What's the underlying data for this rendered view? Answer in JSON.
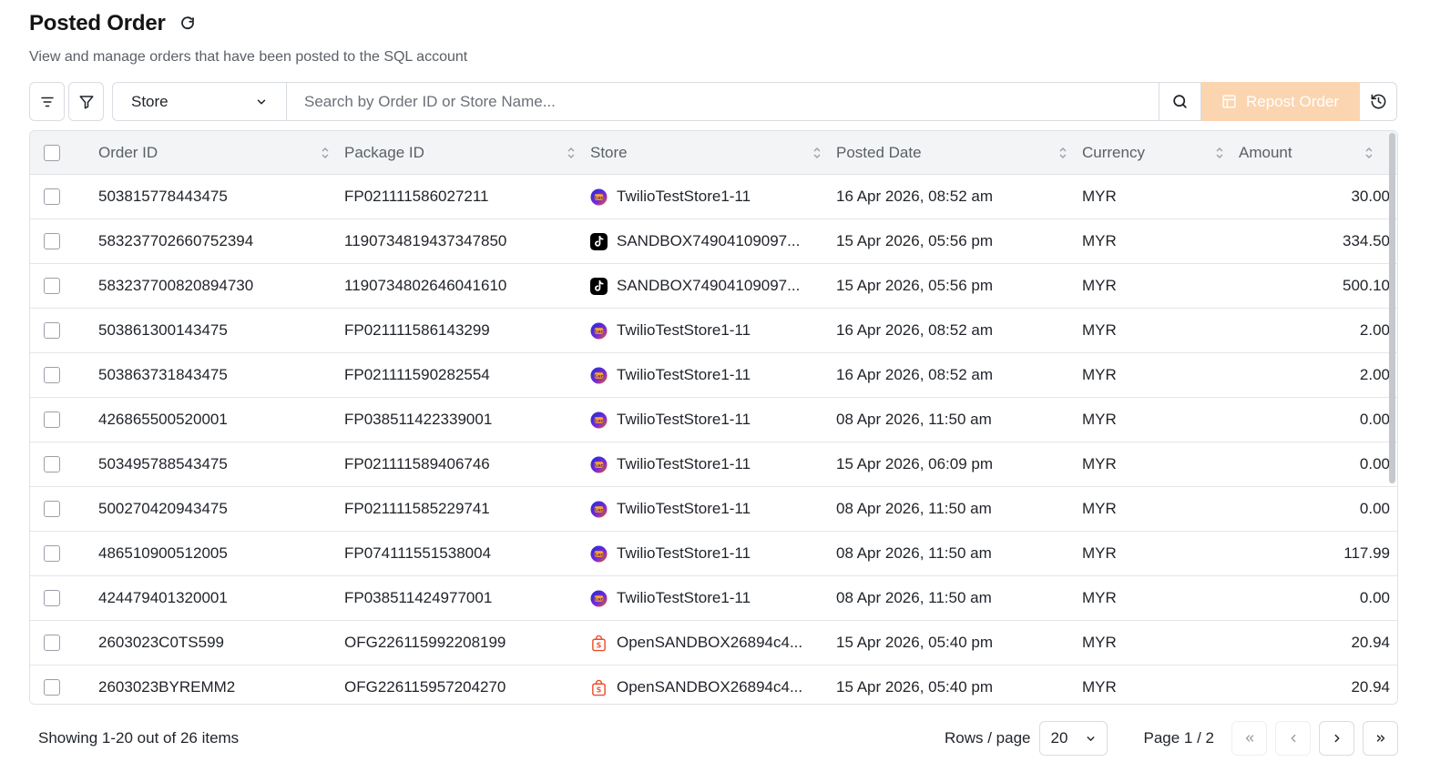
{
  "header": {
    "title": "Posted Order",
    "subtitle": "View and manage orders that have been posted to the SQL account"
  },
  "toolbar": {
    "store_select_label": "Store",
    "search_placeholder": "Search by Order ID or Store Name...",
    "repost_label": "Repost Order"
  },
  "table": {
    "columns": [
      "Order ID",
      "Package ID",
      "Store",
      "Posted Date",
      "Currency",
      "Amount"
    ],
    "rows": [
      {
        "order_id": "503815778443475",
        "package_id": "FP021111586027211",
        "store_icon": "lazada-icon",
        "store": "TwilioTestStore1-11",
        "posted_date": "16 Apr 2026, 08:52 am",
        "currency": "MYR",
        "amount": "30.00"
      },
      {
        "order_id": "583237702660752394",
        "package_id": "1190734819437347850",
        "store_icon": "tiktok-icon",
        "store": "SANDBOX74904109097...",
        "posted_date": "15 Apr 2026, 05:56 pm",
        "currency": "MYR",
        "amount": "334.50"
      },
      {
        "order_id": "583237700820894730",
        "package_id": "1190734802646041610",
        "store_icon": "tiktok-icon",
        "store": "SANDBOX74904109097...",
        "posted_date": "15 Apr 2026, 05:56 pm",
        "currency": "MYR",
        "amount": "500.10"
      },
      {
        "order_id": "503861300143475",
        "package_id": "FP021111586143299",
        "store_icon": "lazada-icon",
        "store": "TwilioTestStore1-11",
        "posted_date": "16 Apr 2026, 08:52 am",
        "currency": "MYR",
        "amount": "2.00"
      },
      {
        "order_id": "503863731843475",
        "package_id": "FP021111590282554",
        "store_icon": "lazada-icon",
        "store": "TwilioTestStore1-11",
        "posted_date": "16 Apr 2026, 08:52 am",
        "currency": "MYR",
        "amount": "2.00"
      },
      {
        "order_id": "426865500520001",
        "package_id": "FP038511422339001",
        "store_icon": "lazada-icon",
        "store": "TwilioTestStore1-11",
        "posted_date": "08 Apr 2026, 11:50 am",
        "currency": "MYR",
        "amount": "0.00"
      },
      {
        "order_id": "503495788543475",
        "package_id": "FP021111589406746",
        "store_icon": "lazada-icon",
        "store": "TwilioTestStore1-11",
        "posted_date": "15 Apr 2026, 06:09 pm",
        "currency": "MYR",
        "amount": "0.00"
      },
      {
        "order_id": "500270420943475",
        "package_id": "FP021111585229741",
        "store_icon": "lazada-icon",
        "store": "TwilioTestStore1-11",
        "posted_date": "08 Apr 2026, 11:50 am",
        "currency": "MYR",
        "amount": "0.00"
      },
      {
        "order_id": "486510900512005",
        "package_id": "FP074111551538004",
        "store_icon": "lazada-icon",
        "store": "TwilioTestStore1-11",
        "posted_date": "08 Apr 2026, 11:50 am",
        "currency": "MYR",
        "amount": "117.99"
      },
      {
        "order_id": "424479401320001",
        "package_id": "FP038511424977001",
        "store_icon": "lazada-icon",
        "store": "TwilioTestStore1-11",
        "posted_date": "08 Apr 2026, 11:50 am",
        "currency": "MYR",
        "amount": "0.00"
      },
      {
        "order_id": "2603023C0TS599",
        "package_id": "OFG226115992208199",
        "store_icon": "shopee-icon",
        "store": "OpenSANDBOX26894c4...",
        "posted_date": "15 Apr 2026, 05:40 pm",
        "currency": "MYR",
        "amount": "20.94"
      },
      {
        "order_id": "2603023BYREMM2",
        "package_id": "OFG226115957204270",
        "store_icon": "shopee-icon",
        "store": "OpenSANDBOX26894c4...",
        "posted_date": "15 Apr 2026, 05:40 pm",
        "currency": "MYR",
        "amount": "20.94"
      }
    ]
  },
  "footer": {
    "showing": "Showing 1-20 out of 26 items",
    "rows_label": "Rows / page",
    "rows_value": "20",
    "page_info": "Page 1 / 2"
  },
  "colors": {
    "repost_bg": "#fbd5b0",
    "lazada": "#5a2ad6",
    "tiktok": "#000000",
    "shopee": "#ee4d2d"
  }
}
